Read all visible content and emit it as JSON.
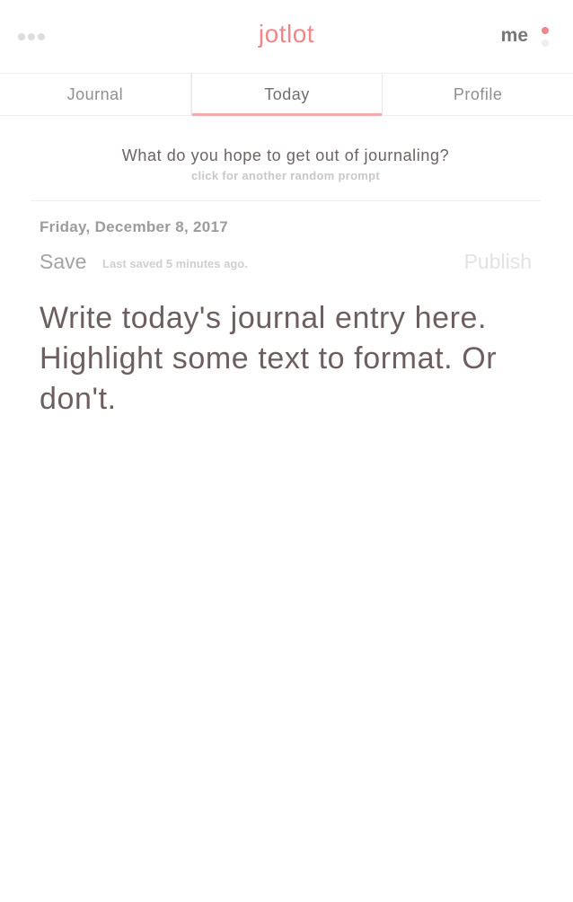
{
  "header": {
    "logo": "jotlot",
    "user_label": "me",
    "menu_icon": "more-dots-icon",
    "user_menu_icon": "vertical-dots-icon"
  },
  "tabs": [
    {
      "label": "Journal",
      "active": false
    },
    {
      "label": "Today",
      "active": true
    },
    {
      "label": "Profile",
      "active": false
    }
  ],
  "prompt": {
    "text": "What do you hope to get out of journaling?",
    "hint": "click for another random prompt"
  },
  "entry": {
    "date": "Friday, December 8, 2017",
    "save_label": "Save",
    "last_saved": "Last saved 5 minutes ago.",
    "publish_label": "Publish",
    "placeholder": "Write today's journal entry here. Highlight some text to format. Or don't."
  },
  "colors": {
    "accent": "#f2858a",
    "accent_light": "#f7aaa9",
    "dot_inactive": "#eeeeee",
    "text": "#6e6262"
  }
}
